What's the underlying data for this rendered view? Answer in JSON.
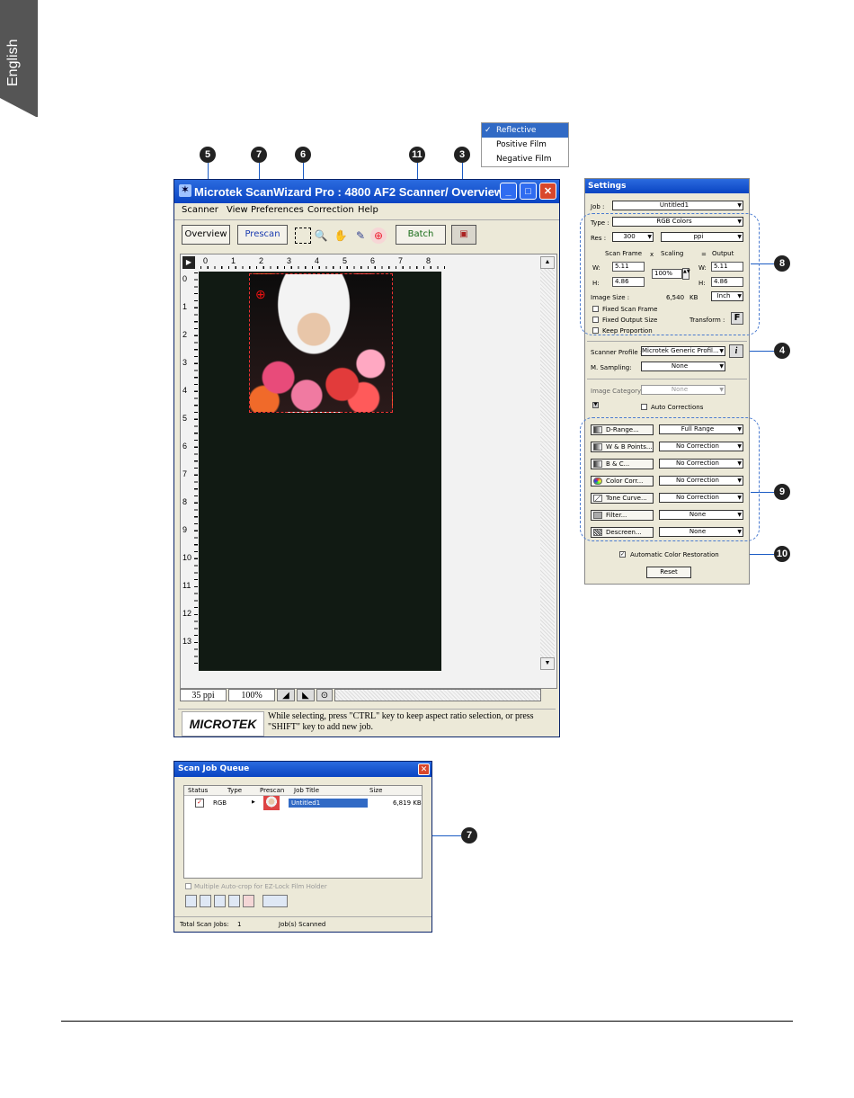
{
  "page": {
    "language_tab": "English"
  },
  "callouts": {
    "c5": "5",
    "c7a": "7",
    "c6": "6",
    "c11": "11",
    "c3": "3",
    "c8": "8",
    "c4": "4",
    "c9": "9",
    "c10": "10",
    "c7b": "7"
  },
  "film_menu": {
    "items": [
      "Reflective",
      "Positive Film",
      "Negative Film"
    ],
    "selected": "Reflective"
  },
  "main_window": {
    "title": "Microtek ScanWizard Pro : 4800 AF2 Scanner/ Overview",
    "menu": [
      "Scanner",
      "View",
      "Preferences",
      "Correction",
      "Help"
    ],
    "toolbar": {
      "overview": "Overview",
      "prescan": "Prescan",
      "batch": "Batch"
    },
    "ruler_h": [
      "0",
      "1",
      "2",
      "3",
      "4",
      "5",
      "6",
      "7",
      "8"
    ],
    "ruler_v": [
      "0",
      "1",
      "2",
      "3",
      "4",
      "5",
      "6",
      "7",
      "8",
      "9",
      "10",
      "11",
      "12",
      "13"
    ],
    "status": {
      "resolution": "35 ppi",
      "zoom": "100%"
    },
    "logo": "MICROTEK",
    "hint": "While selecting, press \"CTRL\" key to keep aspect ratio selection, or press \"SHIFT\" key to add new job."
  },
  "settings": {
    "title": "Settings",
    "job_label": "Job :",
    "job_value": "Untitled1",
    "type_label": "Type :",
    "type_value": "RGB Colors",
    "res_label": "Res :",
    "res_value": "300",
    "res_unit": "ppi",
    "scan_frame": "Scan Frame",
    "x": "x",
    "scaling": "Scaling",
    "eq": "=",
    "output": "Output",
    "w_label": "W:",
    "h_label": "H:",
    "sf_w": "5.11",
    "sf_h": "4.86",
    "scale": "100%",
    "out_w": "5.11",
    "out_h": "4.86",
    "image_size_label": "Image Size :",
    "image_size_value": "6,540",
    "image_size_unit": "KB",
    "unit_value": "Inch",
    "fixed_scan_frame": "Fixed Scan Frame",
    "fixed_output_size": "Fixed Output Size",
    "keep_proportion": "Keep Proportion",
    "transform_label": "Transform :",
    "transform_icon": "F",
    "scanner_profile_label": "Scanner Profile :",
    "scanner_profile_value": "Microtek Generic Profil...",
    "m_sampling_label": "M. Sampling:",
    "m_sampling_value": "None",
    "image_category_label": "Image Category:",
    "image_category_value": "None",
    "auto_corrections": "Auto Corrections",
    "tools": [
      {
        "label": "D-Range...",
        "value": "Full Range"
      },
      {
        "label": "W & B Points...",
        "value": "No Correction"
      },
      {
        "label": "B & C...",
        "value": "No Correction"
      },
      {
        "label": "Color Corr...",
        "value": "No Correction"
      },
      {
        "label": "Tone Curve...",
        "value": "No Correction"
      },
      {
        "label": "Filter...",
        "value": "None"
      },
      {
        "label": "Descreen...",
        "value": "None"
      }
    ],
    "auto_color_restoration": "Automatic Color Restoration",
    "reset": "Reset"
  },
  "queue": {
    "title": "Scan Job Queue",
    "columns": [
      "Status",
      "Type",
      "Prescan",
      "Job Title",
      "Size"
    ],
    "row": {
      "type": "RGB",
      "title": "Untitled1",
      "size": "6,819 KB"
    },
    "multi_autocrop": "Multiple Auto-crop for EZ-Lock Film Holder",
    "total_label": "Total Scan Jobs:",
    "total_value": "1",
    "scanned_label": "Job(s) Scanned"
  }
}
